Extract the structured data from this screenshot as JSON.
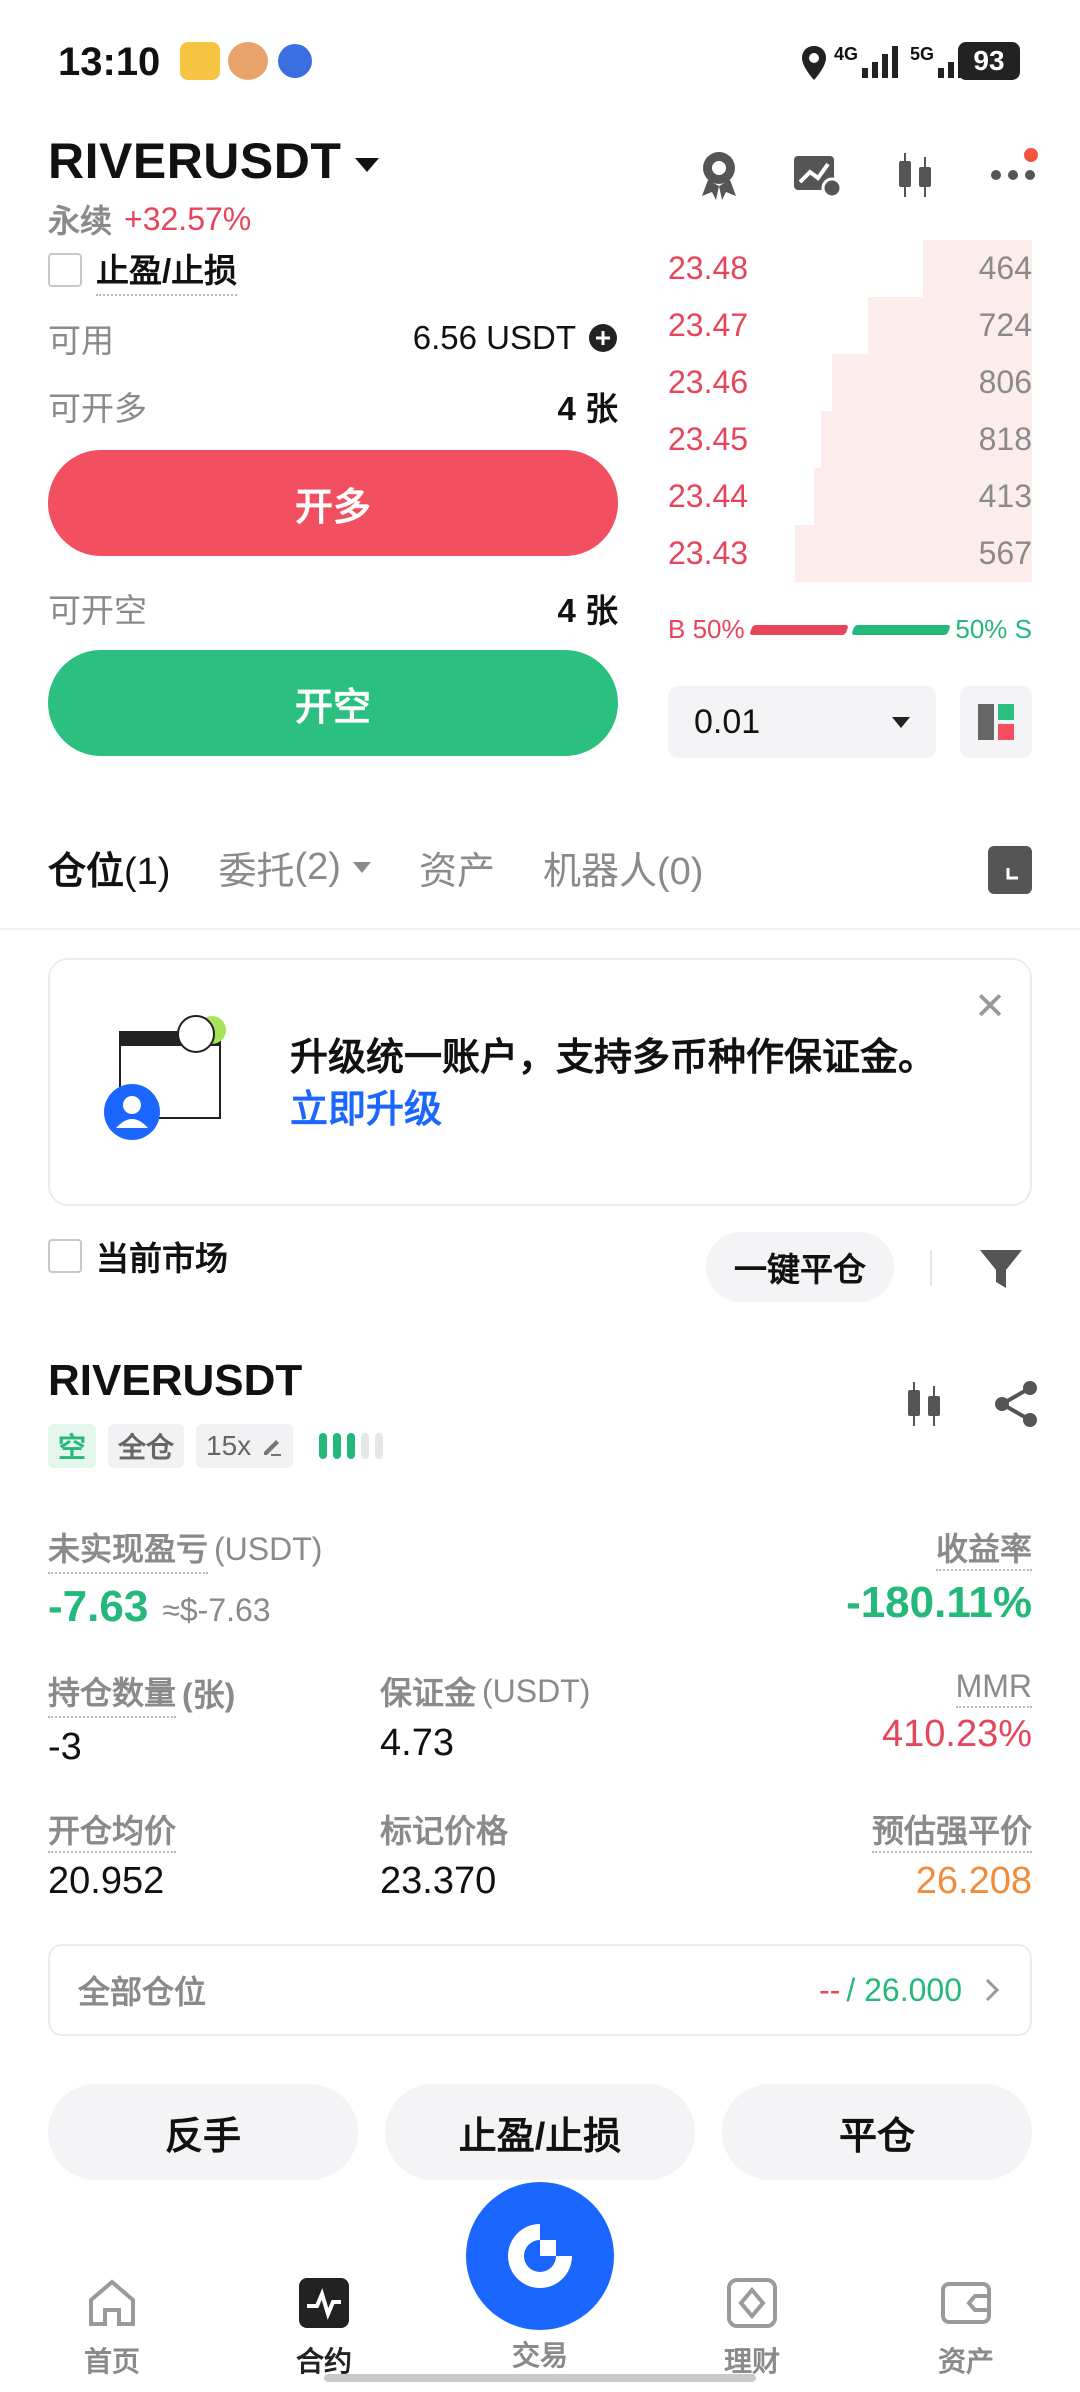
{
  "status_bar": {
    "time": "13:10",
    "network1": "4G",
    "network2": "5G",
    "battery": "93"
  },
  "header": {
    "symbol": "RIVERUSDT",
    "contract_type": "永续",
    "change": "+32.57%"
  },
  "trade_panel": {
    "tpsl_label": "止盈/止损",
    "available_label": "可用",
    "available_value": "6.56 USDT",
    "can_open_long_label": "可开多",
    "can_open_long_value": "4 张",
    "open_long_button": "开多",
    "can_open_short_label": "可开空",
    "can_open_short_value": "4 张",
    "open_short_button": "开空"
  },
  "order_book": {
    "asks": [
      {
        "price": "23.48",
        "qty": "464",
        "depth": 0.3
      },
      {
        "price": "23.47",
        "qty": "724",
        "depth": 0.45
      },
      {
        "price": "23.46",
        "qty": "806",
        "depth": 0.55
      },
      {
        "price": "23.45",
        "qty": "818",
        "depth": 0.58
      },
      {
        "price": "23.44",
        "qty": "413",
        "depth": 0.6
      },
      {
        "price": "23.43",
        "qty": "567",
        "depth": 0.65
      }
    ],
    "buy_ratio": "B 50%",
    "sell_ratio": "50% S",
    "precision": "0.01"
  },
  "tabs": [
    {
      "label": "仓位",
      "count": "(1)"
    },
    {
      "label": "委托",
      "count": "(2)"
    },
    {
      "label": "资产",
      "count": ""
    },
    {
      "label": "机器人",
      "count": "(0)"
    }
  ],
  "banner": {
    "text": "升级统一账户，支持多币种作保证金。",
    "link": "立即升级"
  },
  "filter": {
    "current_market_label": "当前市场",
    "close_all_button": "一键平仓"
  },
  "position": {
    "symbol": "RIVERUSDT",
    "side_tag": "空",
    "margin_mode_tag": "全仓",
    "leverage_tag": "15x",
    "unrealized_pnl_label": "未实现盈亏",
    "unrealized_pnl_unit": "(USDT)",
    "unrealized_pnl": "-7.63",
    "unrealized_pnl_usd": "≈$-7.63",
    "roe_label": "收益率",
    "roe": "-180.11%",
    "size_label": "持仓数量",
    "size_unit": "(张)",
    "size": "-3",
    "margin_label": "保证金",
    "margin_unit": "(USDT)",
    "margin": "4.73",
    "mmr_label": "MMR",
    "mmr": "410.23%",
    "entry_price_label": "开仓均价",
    "entry_price": "20.952",
    "mark_price_label": "标记价格",
    "mark_price": "23.370",
    "liq_price_label": "预估强平价",
    "liq_price": "26.208",
    "all_positions_label": "全部仓位",
    "all_positions_dash": "--",
    "all_positions_value": "/ 26.000",
    "reverse_button": "反手",
    "tpsl_button": "止盈/止损",
    "close_button": "平仓"
  },
  "bottom_nav": [
    {
      "label": "首页"
    },
    {
      "label": "合约"
    },
    {
      "label": "交易"
    },
    {
      "label": "理财"
    },
    {
      "label": "资产"
    }
  ],
  "colors": {
    "long": "#f24f61",
    "short": "#2bc07f",
    "link": "#1a66ff",
    "liq": "#f08c3a"
  }
}
